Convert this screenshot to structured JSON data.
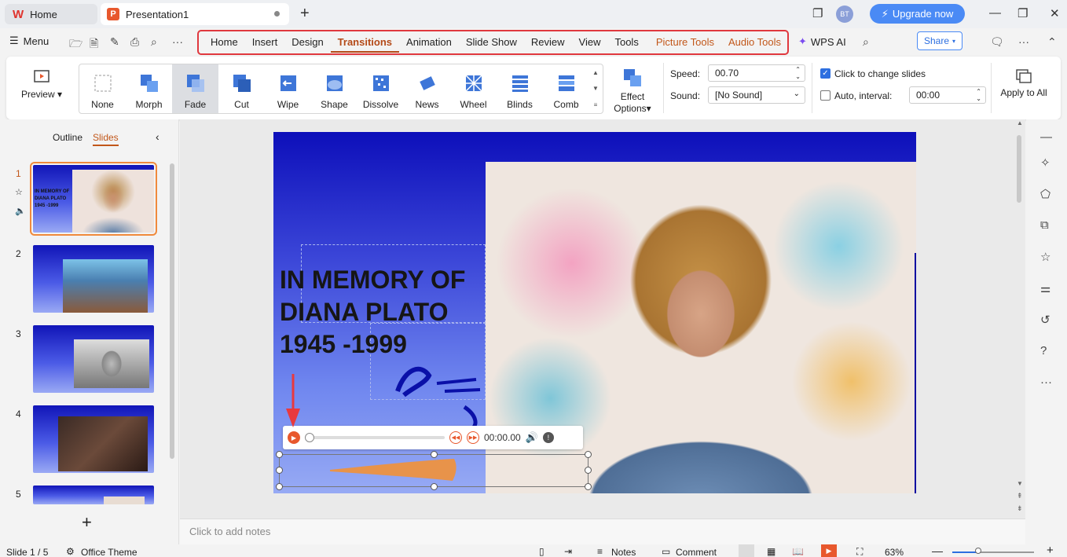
{
  "titlebar": {
    "home_tab": "Home",
    "doc_tab": "Presentation1",
    "avatar_initials": "BT",
    "upgrade_label": "Upgrade now"
  },
  "menubar": {
    "menu_label": "Menu",
    "tabs": [
      "Home",
      "Insert",
      "Design",
      "Transitions",
      "Animation",
      "Slide Show",
      "Review",
      "View",
      "Tools",
      "Picture Tools",
      "Audio Tools"
    ],
    "active_tab": "Transitions",
    "wps_ai": "WPS AI",
    "share": "Share"
  },
  "ribbon": {
    "preview": "Preview",
    "transitions": [
      "None",
      "Morph",
      "Fade",
      "Cut",
      "Wipe",
      "Shape",
      "Dissolve",
      "News",
      "Wheel",
      "Blinds",
      "Comb"
    ],
    "selected_transition": "Fade",
    "effect_options_1": "Effect",
    "effect_options_2": "Options",
    "speed_label": "Speed:",
    "speed_value": "00.70",
    "sound_label": "Sound:",
    "sound_value": "[No Sound]",
    "click_change": "Click to change slides",
    "click_change_checked": true,
    "auto_interval": "Auto, interval:",
    "auto_interval_checked": false,
    "interval_value": "00:00",
    "apply_all": "Apply to All"
  },
  "leftpanel": {
    "outline_tab": "Outline",
    "slides_tab": "Slides",
    "slide_numbers": [
      "1",
      "2",
      "3",
      "4",
      "5"
    ],
    "thumb1_text": "IN MEMORY OF\nDIANA PLATO\n1945 -1999"
  },
  "slide": {
    "title": "IN MEMORY OF\nDIANA PLATO\n1945 -1999",
    "audio_time": "00:00.00"
  },
  "notes": {
    "placeholder": "Click to add notes"
  },
  "status": {
    "slide_info": "Slide 1 / 5",
    "theme": "Office Theme",
    "notes_btn": "Notes",
    "comment_btn": "Comment",
    "zoom": "63%"
  },
  "colors": {
    "accent_orange": "#c2571a",
    "highlight_red": "#e0383e",
    "upgrade_blue": "#4a8af5"
  }
}
